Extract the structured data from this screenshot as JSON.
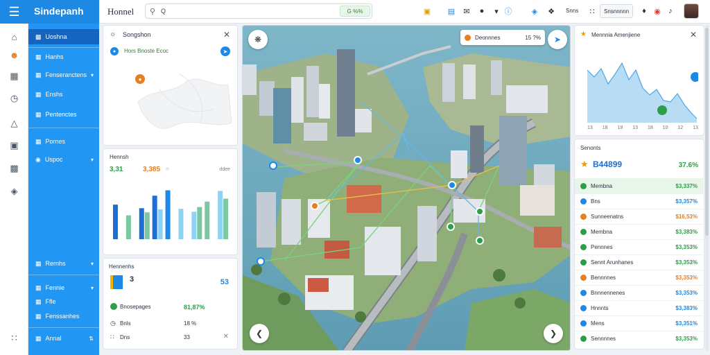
{
  "app": {
    "brand": "Sindepanh",
    "page_title": "Honnel"
  },
  "search": {
    "value": "Q",
    "placeholder": "",
    "button_label": "G %%"
  },
  "topbar": {
    "items": [
      {
        "icon": "badge-icon",
        "label": ""
      },
      {
        "icon": "calendar-icon",
        "label": ""
      },
      {
        "icon": "message-icon",
        "label": ""
      },
      {
        "icon": "camera-icon",
        "label": ""
      },
      {
        "icon": "info-icon",
        "label": ""
      },
      {
        "icon": "shield-icon",
        "label": ""
      },
      {
        "icon": "filter-icon",
        "label": ""
      }
    ],
    "text_1": "Snns",
    "button_label": "Snsnnnnn",
    "colors": {
      "accent": "#1e88e5",
      "green": "#2e9d47"
    }
  },
  "sidebar": {
    "items": [
      {
        "label": "Uoshna",
        "icon": "dashboard-icon"
      },
      {
        "label": "Hanhs",
        "icon": "list-icon"
      },
      {
        "label": "Fenseranctens",
        "icon": "reports-icon"
      },
      {
        "label": "Enshs",
        "icon": "tasks-icon"
      },
      {
        "label": "Pentenctes",
        "icon": "documents-icon"
      },
      {
        "label": "Pornes",
        "icon": "people-icon"
      },
      {
        "label": "Uspoc",
        "icon": "settings-icon"
      },
      {
        "label": "Rernhs",
        "icon": "bell-icon"
      },
      {
        "label": "Fennie",
        "icon": "folder-icon"
      },
      {
        "label": "Ffle",
        "icon": "file-icon"
      },
      {
        "label": "Fenssanhes",
        "icon": "archive-icon"
      },
      {
        "label": "Annal",
        "icon": "grid-icon"
      }
    ]
  },
  "panel_search": {
    "title": "Songshon",
    "subtitle": "Hors Bnoste Ecoc"
  },
  "panel_metrics": {
    "title": "Hennsh",
    "value_a": "3,31",
    "value_b": "3,385",
    "legend": "ddee"
  },
  "chart_data": {
    "type": "bar",
    "title": "",
    "series": [
      {
        "name": "",
        "values": [
          58,
          40,
          52,
          73,
          82,
          51,
          46,
          63,
          81
        ]
      },
      {
        "name": "",
        "values": [
          0,
          0,
          45,
          50,
          0,
          0,
          54,
          0,
          68
        ]
      }
    ],
    "categories": [
      "",
      "",
      "",
      "",
      "",
      "",
      "",
      "",
      ""
    ],
    "colors": [
      "#1e6fd0",
      "#7ac7a0",
      "#8fd3f4"
    ],
    "ylim": [
      0,
      100
    ],
    "grid": false
  },
  "panel_summary": {
    "title": "Hennenhs",
    "big_value": "3",
    "big_right": "53",
    "row1_label": "Bnosepages",
    "row1_value": "81,87%",
    "row2_label": "Bnls",
    "row2_value": "18 %",
    "row3_label": "Dns",
    "row3_value": "33"
  },
  "map": {
    "legend_label": "Deonnnes",
    "legend_value": "15 ?%",
    "markers": [
      "A",
      "B",
      "C",
      "D",
      "E",
      "F",
      "G",
      "H"
    ]
  },
  "panel_trend": {
    "title": "Mennnia Amenjiene",
    "x_ticks": [
      "13",
      "18",
      "19",
      "13",
      "18",
      "10",
      "12",
      "13"
    ]
  },
  "panel_list": {
    "title": "Senonts",
    "headline_value": "B44899",
    "headline_pct": "37.6%",
    "rows": [
      {
        "label": "Membna",
        "value": "$3,337%",
        "color": "#2e9d47",
        "selected": true
      },
      {
        "label": "Bns",
        "value": "$3,357%",
        "color": "#1e88e5"
      },
      {
        "label": "Sunneenatns",
        "value": "$16,53%",
        "color": "#e67e22"
      },
      {
        "label": "Membna",
        "value": "$3,383%",
        "color": "#2e9d47"
      },
      {
        "label": "Pennnes",
        "value": "$3,353%",
        "color": "#2e9d47"
      },
      {
        "label": "Sennt Arunhanes",
        "value": "$3,353%",
        "color": "#2e9d47"
      },
      {
        "label": "Bennnnes",
        "value": "$3,353%",
        "color": "#e67e22"
      },
      {
        "label": "Bnnnennenes",
        "value": "$3,353%",
        "color": "#1e88e5"
      },
      {
        "label": "Hnnnts",
        "value": "$3,383%",
        "color": "#1e88e5"
      },
      {
        "label": "Mens",
        "value": "$3,351%",
        "color": "#1e88e5"
      },
      {
        "label": "Sennnnes",
        "value": "$3,353%",
        "color": "#2e9d47"
      }
    ]
  }
}
